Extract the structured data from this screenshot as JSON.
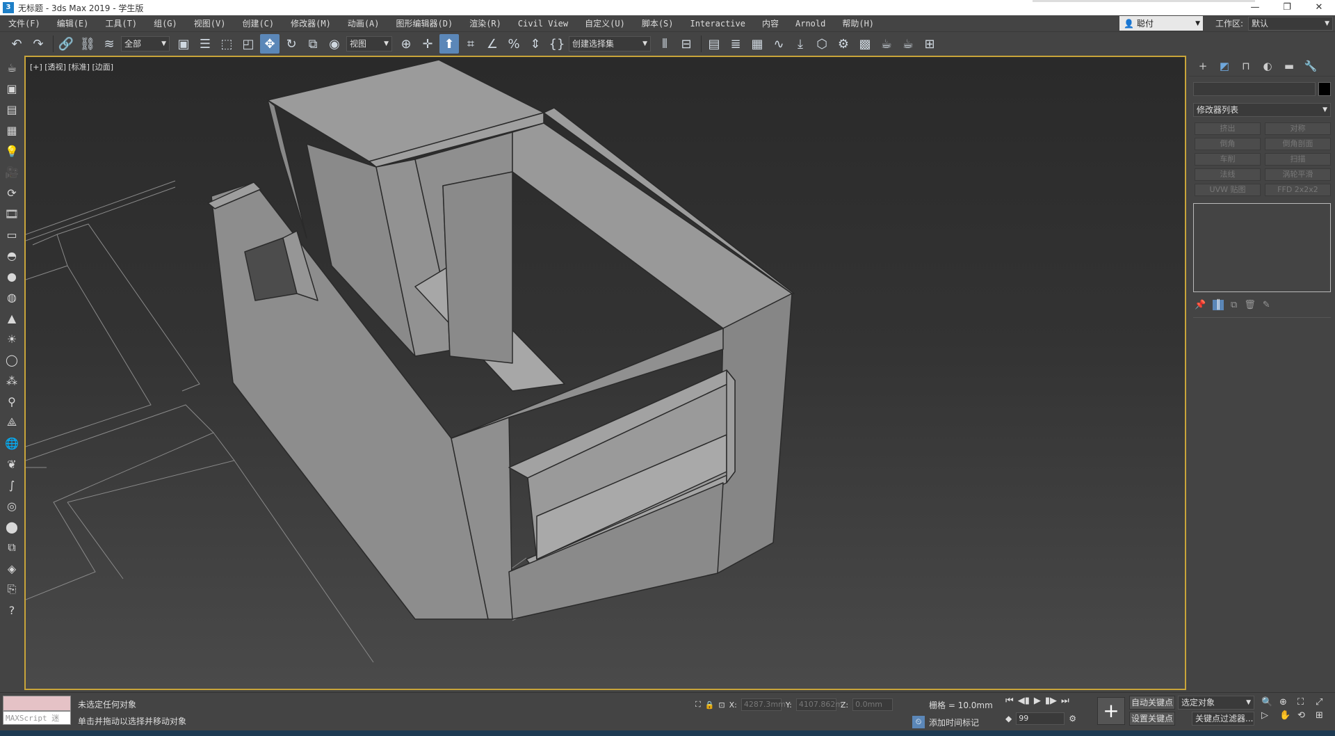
{
  "window": {
    "icon_label": "3",
    "title": "无标题 - 3ds Max 2019  - 学生版",
    "controls": [
      "—",
      "❐",
      "✕"
    ]
  },
  "menu": {
    "items": [
      "文件(F)",
      "编辑(E)",
      "工具(T)",
      "组(G)",
      "视图(V)",
      "创建(C)",
      "修改器(M)",
      "动画(A)",
      "图形编辑器(D)",
      "渲染(R)",
      "Civil View",
      "自定义(U)",
      "脚本(S)",
      "Interactive",
      "内容",
      "Arnold",
      "帮助(H)"
    ],
    "user": "聪付",
    "workspace_label": "工作区:",
    "workspace_value": "默认"
  },
  "toolbar": {
    "selection_filter": "全部",
    "ref_coord": "视图",
    "named_selection": "创建选择集"
  },
  "viewport": {
    "label": "[+] [透视] [标准] [边面]"
  },
  "command_panel": {
    "modifier_list": "修改器列表",
    "modifier_buttons": [
      "挤出",
      "对称",
      "倒角",
      "倒角剖面",
      "车削",
      "扫描",
      "法线",
      "涡轮平滑",
      "UVW 贴图",
      "FFD 2x2x2"
    ]
  },
  "status": {
    "maxscript_label": "MAXScript 迷",
    "line1": "未选定任何对象",
    "line2": "单击并拖动以选择并移动对象",
    "x_label": "X:",
    "x_value": "4287.3mm",
    "y_label": "Y:",
    "y_value": "4107.862m",
    "z_label": "Z:",
    "z_value": "0.0mm",
    "grid": "栅格 = 10.0mm",
    "add_time_tag": "添加时间标记",
    "frame": "99",
    "auto_key": "自动关键点",
    "set_key": "设置关键点",
    "selected_object": "选定对象",
    "key_filters": "关键点过滤器..."
  },
  "colors": {
    "viewport_border": "#c9a53a",
    "active_tool": "#5b87b8",
    "wall_light": "#9a9a9a",
    "wall_mid": "#8c8c8c",
    "wall_dark": "#808080"
  }
}
